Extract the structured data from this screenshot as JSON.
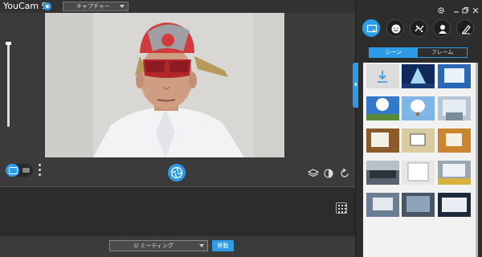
{
  "app": {
    "title": "YouCam 9"
  },
  "header": {
    "capture_label": "キャプチャー"
  },
  "toolbar": {
    "camera_mode": "camera",
    "video_mode": "video"
  },
  "bottom": {
    "meeting_label": "U ミーティング",
    "move_label": "移動"
  },
  "panel": {
    "tabs": [
      {
        "label": "シーン",
        "active": true
      },
      {
        "label": "フレーム",
        "active": false
      }
    ],
    "categories": [
      "scene-icon",
      "emoji-icon",
      "effects-icon",
      "avatar-icon",
      "brush-icon"
    ]
  },
  "colors": {
    "accent": "#2e9be8",
    "panel_bg": "#2d2d2d",
    "main_bg": "#3b3b3b"
  }
}
